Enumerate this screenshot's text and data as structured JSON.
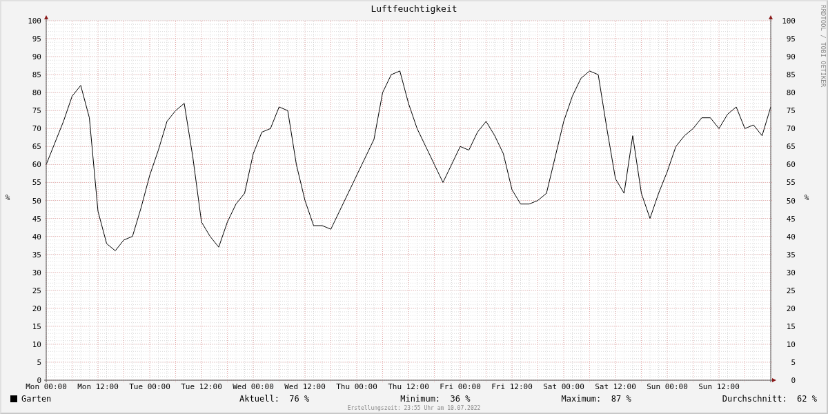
{
  "chart": {
    "right_ylabel": "%",
    "watermark": "RRDTOOL / TOBI OETIKER",
    "right_yticks": [
      "100",
      "95",
      "90",
      "85",
      "80",
      "75",
      "70",
      "65",
      "60",
      "55",
      "50",
      "45",
      "40",
      "35",
      "30",
      "25",
      "20",
      "15",
      "10",
      "5",
      "0"
    ],
    "chart_data": {
      "type": "line",
      "grid": true,
      "title": "Luftfeuchtigkeit",
      "ylabel": "%",
      "ylim": [
        0,
        100
      ],
      "categories": [
        "Mon 00:00",
        null,
        null,
        null,
        null,
        null,
        "Mon 12:00",
        null,
        null,
        null,
        null,
        null,
        "Tue 00:00",
        null,
        null,
        null,
        null,
        null,
        "Tue 12:00",
        null,
        null,
        null,
        null,
        null,
        "Wed 00:00",
        null,
        null,
        null,
        null,
        null,
        "Wed 12:00",
        null,
        null,
        null,
        null,
        null,
        "Thu 00:00",
        null,
        null,
        null,
        null,
        null,
        "Thu 12:00",
        null,
        null,
        null,
        null,
        null,
        "Fri 00:00",
        null,
        null,
        null,
        null,
        null,
        "Fri 12:00",
        null,
        null,
        null,
        null,
        null,
        "Sat 00:00",
        null,
        null,
        null,
        null,
        null,
        "Sat 12:00",
        null,
        null,
        null,
        null,
        null,
        "Sun 00:00",
        null,
        null,
        null,
        null,
        null,
        "Sun 12:00",
        null,
        null,
        null,
        null,
        null,
        null
      ],
      "series": [
        {
          "name": "Garten",
          "color": "#000000",
          "values": [
            60,
            66,
            72,
            79,
            82,
            73,
            47,
            38,
            36,
            39,
            40,
            48,
            57,
            64,
            72,
            75,
            77,
            62,
            44,
            40,
            37,
            44,
            49,
            52,
            63,
            69,
            70,
            76,
            75,
            60,
            50,
            43,
            43,
            42,
            47,
            52,
            57,
            62,
            67,
            80,
            85,
            86,
            77,
            70,
            65,
            60,
            55,
            60,
            65,
            64,
            69,
            72,
            68,
            63,
            53,
            49,
            49,
            50,
            52,
            62,
            72,
            79,
            84,
            86,
            85,
            70,
            56,
            52,
            68,
            52,
            45,
            52,
            58,
            65,
            68,
            70,
            73,
            73,
            70,
            74,
            76,
            70,
            71,
            68,
            76
          ]
        }
      ],
      "yticks": [
        0,
        5,
        10,
        15,
        20,
        25,
        30,
        35,
        40,
        45,
        50,
        55,
        60,
        65,
        70,
        75,
        80,
        85,
        90,
        95,
        100
      ]
    }
  },
  "legend": {
    "stats": [
      {
        "label": "Aktuell:",
        "value": "76 %"
      },
      {
        "label": "Minimum:",
        "value": "36 %"
      },
      {
        "label": "Maximum:",
        "value": "87 %"
      },
      {
        "label": "Durchschnitt:",
        "value": "62 %"
      }
    ]
  },
  "footer": "Erstellungszeit: 23:55 Uhr am 10.07.2022"
}
